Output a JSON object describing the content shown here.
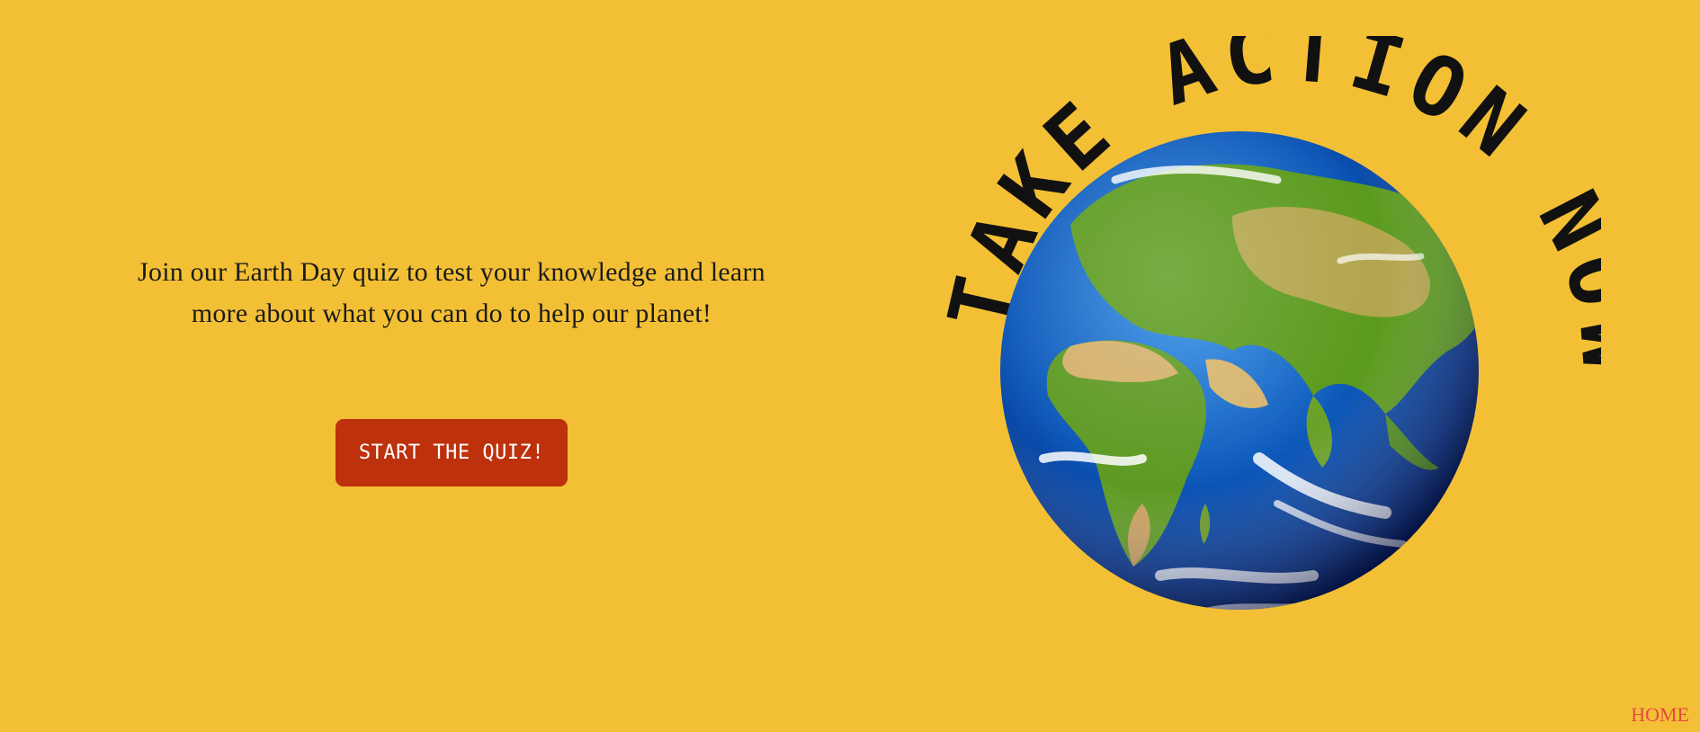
{
  "intro": {
    "text": "Join our Earth Day quiz to test your knowledge and learn more about what you can do to help our planet!"
  },
  "cta": {
    "label": "START THE QUIZ!"
  },
  "hero": {
    "arc_text": "TAKE ACTION NOW",
    "image": "earth-globe"
  },
  "nav": {
    "home": "HOME"
  },
  "colors": {
    "background": "#f3c035",
    "button": "#bd310c",
    "button_text": "#ffffff",
    "text": "#1b1b1b",
    "home_link": "#e64a40"
  }
}
